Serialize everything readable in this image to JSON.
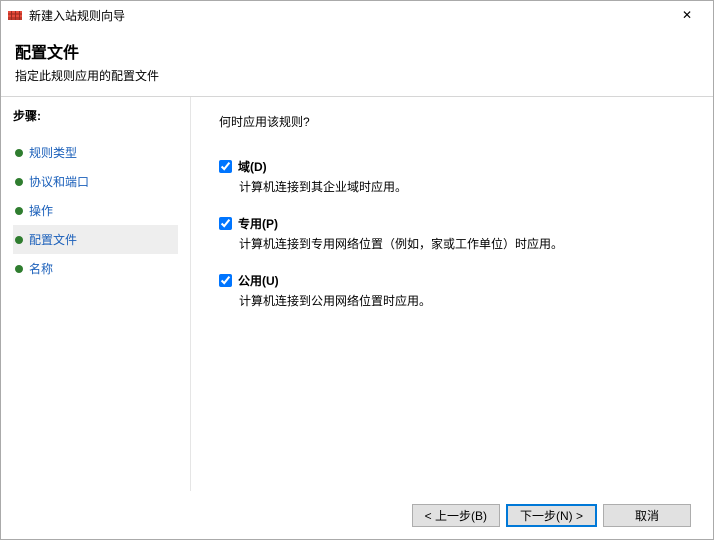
{
  "window": {
    "title": "新建入站规则向导",
    "close_symbol": "✕"
  },
  "header": {
    "title": "配置文件",
    "subtitle": "指定此规则应用的配置文件"
  },
  "sidebar": {
    "steps_label": "步骤:",
    "items": [
      {
        "label": "规则类型"
      },
      {
        "label": "协议和端口"
      },
      {
        "label": "操作"
      },
      {
        "label": "配置文件"
      },
      {
        "label": "名称"
      }
    ]
  },
  "content": {
    "prompt": "何时应用该规则?",
    "options": [
      {
        "label": "域(D)",
        "desc": "计算机连接到其企业域时应用。"
      },
      {
        "label": "专用(P)",
        "desc": "计算机连接到专用网络位置（例如，家或工作单位）时应用。"
      },
      {
        "label": "公用(U)",
        "desc": "计算机连接到公用网络位置时应用。"
      }
    ]
  },
  "footer": {
    "back": "< 上一步(B)",
    "next": "下一步(N) >",
    "cancel": "取消"
  }
}
